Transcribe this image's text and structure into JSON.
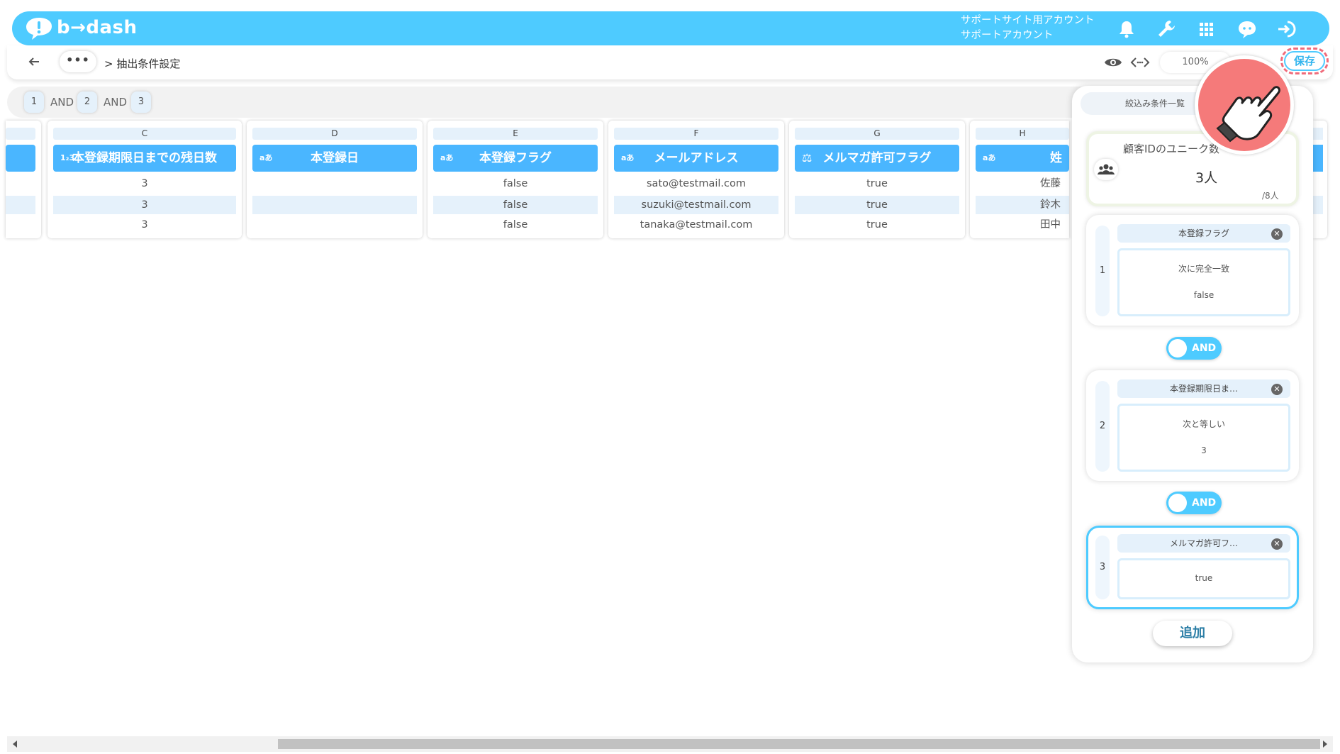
{
  "header": {
    "logo_text": "b→dash",
    "account_line1": "サポートサイト用アカウント",
    "account_line2": "サポートアカウント",
    "icons": [
      "bell-icon",
      "wrench-icon",
      "apps-grid-icon",
      "chat-icon",
      "logout-icon"
    ]
  },
  "toolbar": {
    "more_label": "•••",
    "breadcrumb": "> 抽出条件設定",
    "zoom": "100%",
    "save_label": "保存"
  },
  "formula": {
    "items": [
      "1",
      "AND",
      "2",
      "AND",
      "3"
    ]
  },
  "table": {
    "columns": [
      {
        "letter": "C",
        "name": "本登録期限日までの残日数",
        "type_icon": "1₂3",
        "cells": [
          "3",
          "3",
          "3"
        ]
      },
      {
        "letter": "D",
        "name": "本登録日",
        "type_icon": "aあ",
        "cells": [
          "",
          "",
          ""
        ]
      },
      {
        "letter": "E",
        "name": "本登録フラグ",
        "type_icon": "aあ",
        "cells": [
          "false",
          "false",
          "false"
        ]
      },
      {
        "letter": "F",
        "name": "メールアドレス",
        "type_icon": "aあ",
        "cells": [
          "sato@testmail.com",
          "suzuki@testmail.com",
          "tanaka@testmail.com"
        ]
      },
      {
        "letter": "G",
        "name": "メルマガ許可フラグ",
        "type_icon": "⚖",
        "cells": [
          "true",
          "true",
          "true"
        ]
      },
      {
        "letter": "H",
        "name": "姓",
        "type_icon": "aあ",
        "cells": [
          "佐藤",
          "鈴木",
          "田中"
        ]
      }
    ]
  },
  "panel": {
    "tab_label": "絞込み条件一覧",
    "unique_label": "顧客IDのユニーク数",
    "unique_count": "3人",
    "unique_total": "/8人",
    "conditions": [
      {
        "num": "1",
        "title": "本登録フラグ",
        "operator": "次に完全一致",
        "value": "false"
      },
      {
        "num": "2",
        "title": "本登録期限日ま…",
        "operator": "次と等しい",
        "value": "3"
      },
      {
        "num": "3",
        "title": "メルマガ許可フ…",
        "operator": "",
        "value": "true"
      }
    ],
    "connectors": [
      "AND",
      "AND"
    ],
    "add_label": "追加"
  },
  "colors": {
    "header_bg": "#4ecbff",
    "column_header": "#4ab6ff",
    "alt_row": "#e5f1fb",
    "highlight_red": "#f57a7a"
  }
}
